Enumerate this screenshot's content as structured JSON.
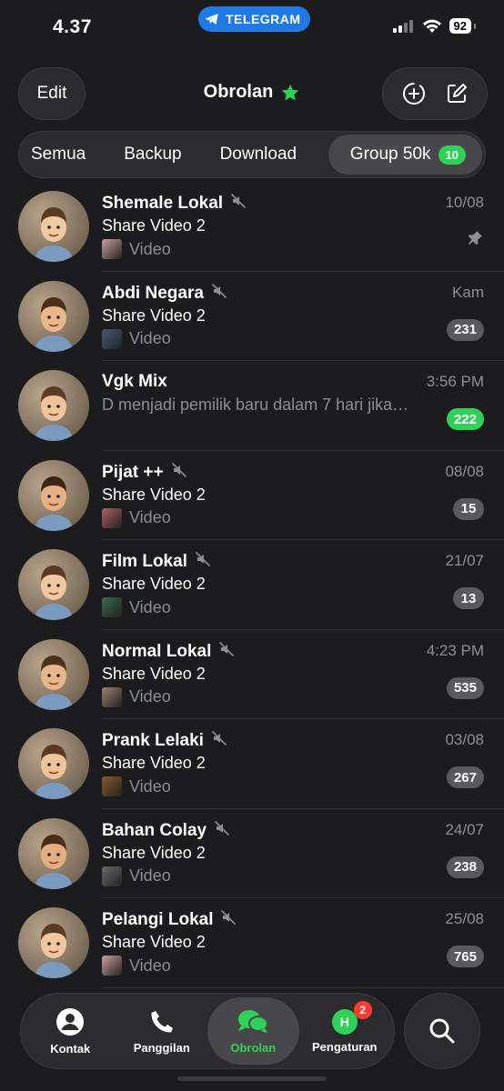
{
  "status_bar": {
    "time": "4.37",
    "app_pill": "TELEGRAM",
    "battery": "92"
  },
  "navbar": {
    "edit_label": "Edit",
    "title": "Obrolan"
  },
  "filters": [
    {
      "label": "Semua"
    },
    {
      "label": "Backup"
    },
    {
      "label": "Download"
    },
    {
      "label": "Group 50k",
      "count": "10",
      "active": true
    }
  ],
  "chats": [
    {
      "name": "Shemale Lokal",
      "muted": true,
      "time": "10/08",
      "preview": "Share Video 2",
      "sub": "Video",
      "pinned": true,
      "thumb_color": "#c9a0a0"
    },
    {
      "name": "Abdi Negara",
      "muted": true,
      "time": "Kam",
      "preview": "Share Video 2",
      "sub": "Video",
      "badge": "231",
      "thumb_color": "#4a5a7a"
    },
    {
      "name": "Vgk Mix",
      "muted": false,
      "time": "3:56 PM",
      "preview": "D menjadi pemilik baru dalam 7 hari jika…",
      "badge": "222",
      "badge_color": "green"
    },
    {
      "name": "Pijat ++",
      "muted": true,
      "time": "08/08",
      "preview": "Share Video 2",
      "sub": "Video",
      "badge": "15",
      "thumb_color": "#b06060"
    },
    {
      "name": "Film Lokal",
      "muted": true,
      "time": "21/07",
      "preview": "Share Video 2",
      "sub": "Video",
      "badge": "13",
      "thumb_color": "#3a6a4a"
    },
    {
      "name": "Normal Lokal",
      "muted": true,
      "time": "4:23 PM",
      "preview": "Share Video 2",
      "sub": "Video",
      "badge": "535",
      "thumb_color": "#a08070"
    },
    {
      "name": "Prank Lelaki",
      "muted": true,
      "time": "03/08",
      "preview": "Share Video 2",
      "sub": "Video",
      "badge": "267",
      "thumb_color": "#8a5a30"
    },
    {
      "name": "Bahan Colay",
      "muted": true,
      "time": "24/07",
      "preview": "Share Video 2",
      "sub": "Video",
      "badge": "238",
      "thumb_color": "#6a6a6a"
    },
    {
      "name": "Pelangi Lokal",
      "muted": true,
      "time": "25/08",
      "preview": "Share Video 2",
      "sub": "Video",
      "badge": "765",
      "thumb_color": "#d0a0a0"
    }
  ],
  "tabbar": [
    {
      "label": "Kontak",
      "icon": "person-icon"
    },
    {
      "label": "Panggilan",
      "icon": "phone-icon"
    },
    {
      "label": "Obrolan",
      "icon": "chat-bubbles-icon",
      "active": true
    },
    {
      "label": "Pengaturan",
      "icon": "avatar-h",
      "avatar_letter": "H",
      "badge": "2"
    }
  ],
  "colors": {
    "accent": "#30d158",
    "telegram_blue": "#1f7ae6",
    "background": "#1c1c1e",
    "badge_grey": "#5a5a5e",
    "red": "#ff3b30"
  }
}
